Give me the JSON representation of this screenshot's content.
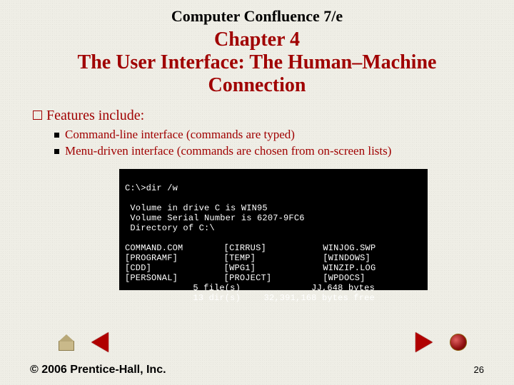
{
  "header": {
    "book_title": "Computer Confluence 7/e",
    "chapter_number": "Chapter 4",
    "chapter_title": "The User Interface: The Human–Machine Connection"
  },
  "body": {
    "features_label": "Features include:",
    "bullets": {
      "b0": "Command-line interface (commands are typed)",
      "b1": "Menu-driven interface (commands are chosen from on-screen lists)"
    }
  },
  "terminal": {
    "prompt": "C:\\>dir /w",
    "blank": " ",
    "l1": " Volume in drive C is WIN95",
    "l2": " Volume Serial Number is 6207-9FC6",
    "l3": " Directory of C:\\",
    "cols": {
      "c00": "COMMAND.COM",
      "c01": "[CIRRUS]",
      "c02": "WINJOG.SWP",
      "c10": "[PROGRAMF]",
      "c11": "[TEMP]",
      "c12": "[WINDOWS]",
      "c20": "[CDD]",
      "c21": "[WPG1]",
      "c22": "WINZIP.LOG",
      "c30": "[PERSONAL]",
      "c31": "[PROJECT]",
      "c32": "[WPDOCS]"
    },
    "stat_files_l": "5 file(s)",
    "stat_files_r": "JJ,648 bytes",
    "stat_dirs_l": "13 dir(s)",
    "stat_dirs_r": "32,391,168 bytes free"
  },
  "footer": {
    "copyright": "© 2006 Prentice-Hall, Inc.",
    "page_number": "26"
  }
}
